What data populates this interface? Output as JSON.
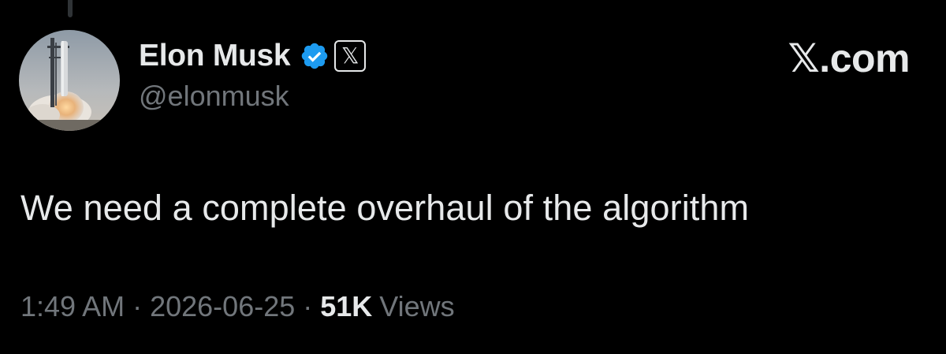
{
  "tweet": {
    "author": {
      "display_name": "Elon Musk",
      "handle": "@elonmusk",
      "verified_icon": "verified-badge-icon",
      "affiliate_badge": "𝕏",
      "avatar": "starship-launch-avatar"
    },
    "brand": "𝕏.com",
    "text": "We need a complete overhaul of the algorithm",
    "meta": {
      "time": "1:49 AM",
      "separator": "·",
      "date": "2026-06-25",
      "views_count": "51K",
      "views_label": "Views"
    }
  },
  "colors": {
    "background": "#000000",
    "primary_text": "#e7e9ea",
    "secondary_text": "#71767b",
    "verified_blue": "#1d9bf0"
  }
}
